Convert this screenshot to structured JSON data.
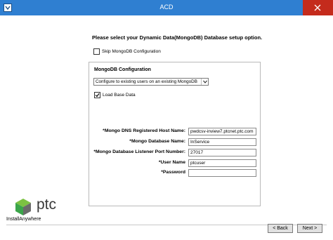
{
  "window": {
    "title": "ACD",
    "icon": "installer-app-icon",
    "close_icon": "close-icon"
  },
  "colors": {
    "titlebar": "#2f7fd1",
    "close_button": "#c42b1c",
    "logo_green": "#3ba54a",
    "logo_text": "#3a3a3a"
  },
  "page": {
    "heading": "Please select your Dynamic Data(MongoDB) Database setup option."
  },
  "skip_config": {
    "label": "Skip MongoDB Configuration",
    "checked": false
  },
  "mongodb": {
    "title": "MongoDB Configuration",
    "option_select": {
      "value": "Configure to existing users on an existing MongoDB"
    },
    "load_base_data": {
      "label": "Load Base Data",
      "checked": true
    },
    "fields": {
      "host": {
        "label": "*Mongo DNS Registered Host Name:",
        "value": "pwdcsv-inview7.ptcnet.ptc.com"
      },
      "dbname": {
        "label": "*Mongo Database Name:",
        "value": "InService"
      },
      "port": {
        "label": "*Mongo Database Listener Port Number:",
        "value": "27017"
      },
      "user": {
        "label": "*User Name",
        "value": "ptcuser"
      },
      "password": {
        "label": "*Password",
        "value": ""
      }
    }
  },
  "branding": {
    "logo_text": "ptc",
    "installer": "InstallAnywhere"
  },
  "buttons": {
    "back": "< Back",
    "next": "Next >"
  }
}
